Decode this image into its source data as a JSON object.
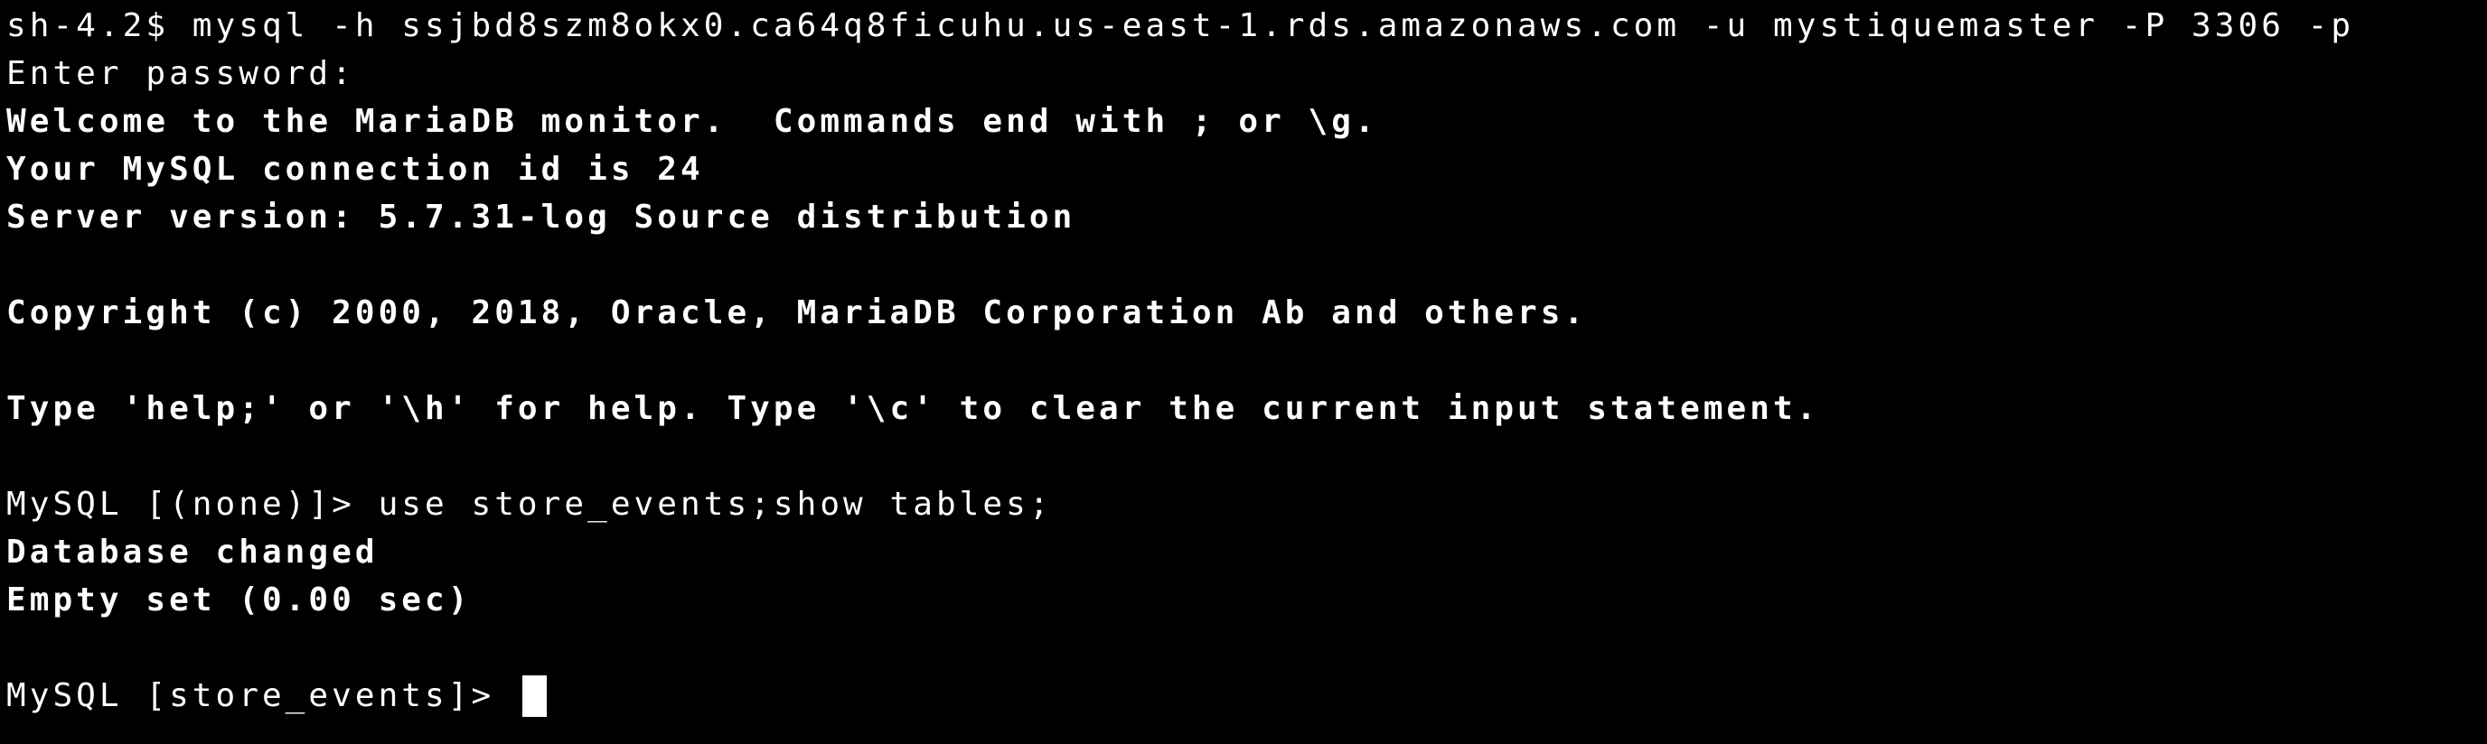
{
  "terminal": {
    "background_color": "#000000",
    "foreground_color": "#ffffff",
    "cursor_color": "#ffffff",
    "shell_prompt": "sh-4.2$",
    "lines": [
      {
        "id": "shell-command",
        "text": "sh-4.2$ mysql -h ssjbd8szm8okx0.ca64q8ficuhu.us-east-1.rds.amazonaws.com -u mystiquemaster -P 3306 -p",
        "bold": false
      },
      {
        "id": "password-prompt",
        "text": "Enter password:",
        "bold": false
      },
      {
        "id": "welcome-banner",
        "text": "Welcome to the MariaDB monitor.  Commands end with ; or \\g.",
        "bold": true
      },
      {
        "id": "connection-id",
        "text": "Your MySQL connection id is 24",
        "bold": true
      },
      {
        "id": "server-version",
        "text": "Server version: 5.7.31-log Source distribution",
        "bold": true
      },
      {
        "id": "blank-1",
        "text": "",
        "bold": false
      },
      {
        "id": "copyright",
        "text": "Copyright (c) 2000, 2018, Oracle, MariaDB Corporation Ab and others.",
        "bold": true
      },
      {
        "id": "blank-2",
        "text": "",
        "bold": false
      },
      {
        "id": "help-hint",
        "text": "Type 'help;' or '\\h' for help. Type '\\c' to clear the current input statement.",
        "bold": true
      },
      {
        "id": "blank-3",
        "text": "",
        "bold": false
      },
      {
        "id": "sql-command",
        "text": "MySQL [(none)]> use store_events;show tables;",
        "bold": false
      },
      {
        "id": "database-changed",
        "text": "Database changed",
        "bold": true
      },
      {
        "id": "empty-set",
        "text": "Empty set (0.00 sec)",
        "bold": true
      },
      {
        "id": "blank-4",
        "text": "",
        "bold": false
      }
    ],
    "active_prompt": {
      "text": "MySQL [store_events]> ",
      "database": "store_events",
      "cursor_visible": true
    }
  }
}
